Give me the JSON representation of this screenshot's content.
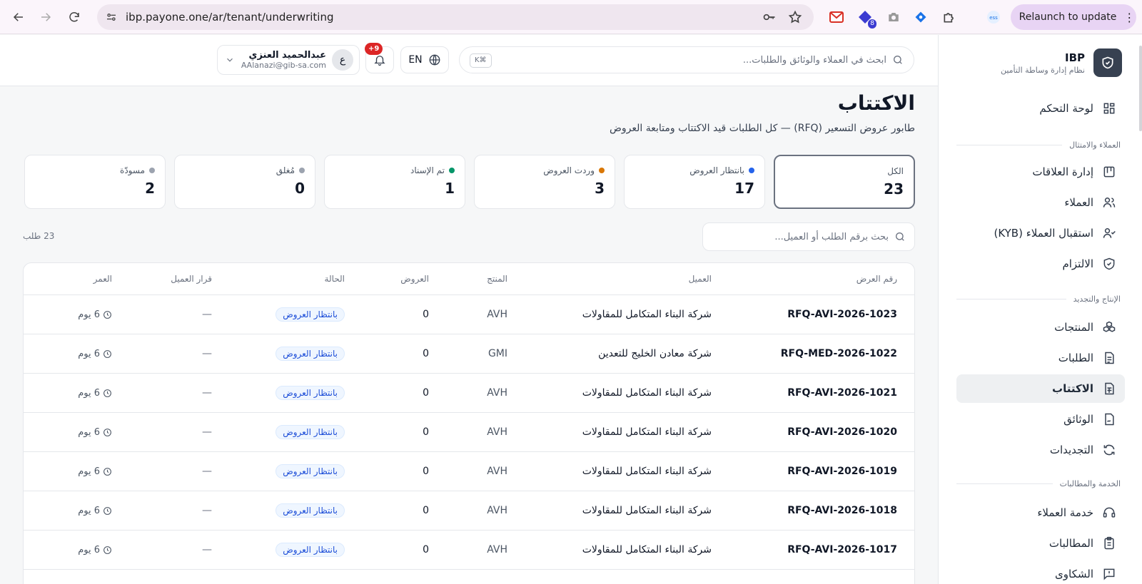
{
  "browser": {
    "url": "ibp.payone.one/ar/tenant/underwriting",
    "relaunch_label": "Relaunch to update",
    "ext_badge": "8"
  },
  "sidebar": {
    "brand_name": "IBP",
    "brand_sub": "نظام إدارة وساطة التأمين",
    "dashboard": "لوحة التحكم",
    "section_clients": "العملاء والامتثال",
    "relationships": "إدارة العلاقات",
    "clients": "العملاء",
    "kyb": "استقبال العملاء (KYB)",
    "compliance": "الالتزام",
    "section_production": "الإنتاج والتجديد",
    "products": "المنتجات",
    "requests": "الطلبات",
    "underwriting": "الاكتتاب",
    "documents": "الوثائق",
    "renewals": "التجديدات",
    "section_service": "الخدمة والمطالبات",
    "customer_service": "خدمة العملاء",
    "claims": "المطالبات",
    "complaints": "الشكاوى"
  },
  "topbar": {
    "search_placeholder": "ابحث في العملاء والوثائق والطلبات...",
    "shortcut": "K⌘",
    "lang": "EN",
    "notif_count": "+9",
    "user_initial": "ع",
    "user_name": "عبدالحميد العنزي",
    "user_email": "AAlanazi@gib-sa.com"
  },
  "page": {
    "title": "الاكتتاب",
    "subtitle": "طابور عروض التسعير (RFQ) — كل الطلبات قيد الاكتتاب ومتابعة العروض",
    "search_placeholder": "بحث برقم الطلب أو العميل...",
    "count_label": "23 طلب"
  },
  "stats": [
    {
      "label": "الكل",
      "value": "23",
      "color": ""
    },
    {
      "label": "بانتظار العروض",
      "value": "17",
      "color": "#2563eb"
    },
    {
      "label": "وردت العروض",
      "value": "3",
      "color": "#d97706"
    },
    {
      "label": "تم الإسناد",
      "value": "1",
      "color": "#059669"
    },
    {
      "label": "مُغلق",
      "value": "0",
      "color": "#9ca3af"
    },
    {
      "label": "مسودّة",
      "value": "2",
      "color": "#9ca3af"
    }
  ],
  "table": {
    "headers": {
      "id": "رقم العرض",
      "client": "العميل",
      "product": "المنتج",
      "offers": "العروض",
      "status": "الحالة",
      "decision": "قرار العميل",
      "age": "العمر"
    },
    "rows": [
      {
        "id": "RFQ-AVI-2026-1023",
        "client": "شركة البناء المتكامل للمقاولات",
        "product": "AVH",
        "offers": "0",
        "status": "بانتظار العروض",
        "decision": "—",
        "age": "6 يوم"
      },
      {
        "id": "RFQ-MED-2026-1022",
        "client": "شركة معادن الخليج للتعدين",
        "product": "GMI",
        "offers": "0",
        "status": "بانتظار العروض",
        "decision": "—",
        "age": "6 يوم"
      },
      {
        "id": "RFQ-AVI-2026-1021",
        "client": "شركة البناء المتكامل للمقاولات",
        "product": "AVH",
        "offers": "0",
        "status": "بانتظار العروض",
        "decision": "—",
        "age": "6 يوم"
      },
      {
        "id": "RFQ-AVI-2026-1020",
        "client": "شركة البناء المتكامل للمقاولات",
        "product": "AVH",
        "offers": "0",
        "status": "بانتظار العروض",
        "decision": "—",
        "age": "6 يوم"
      },
      {
        "id": "RFQ-AVI-2026-1019",
        "client": "شركة البناء المتكامل للمقاولات",
        "product": "AVH",
        "offers": "0",
        "status": "بانتظار العروض",
        "decision": "—",
        "age": "6 يوم"
      },
      {
        "id": "RFQ-AVI-2026-1018",
        "client": "شركة البناء المتكامل للمقاولات",
        "product": "AVH",
        "offers": "0",
        "status": "بانتظار العروض",
        "decision": "—",
        "age": "6 يوم"
      },
      {
        "id": "RFQ-AVI-2026-1017",
        "client": "شركة البناء المتكامل للمقاولات",
        "product": "AVH",
        "offers": "0",
        "status": "بانتظار العروض",
        "decision": "—",
        "age": "6 يوم"
      }
    ]
  }
}
